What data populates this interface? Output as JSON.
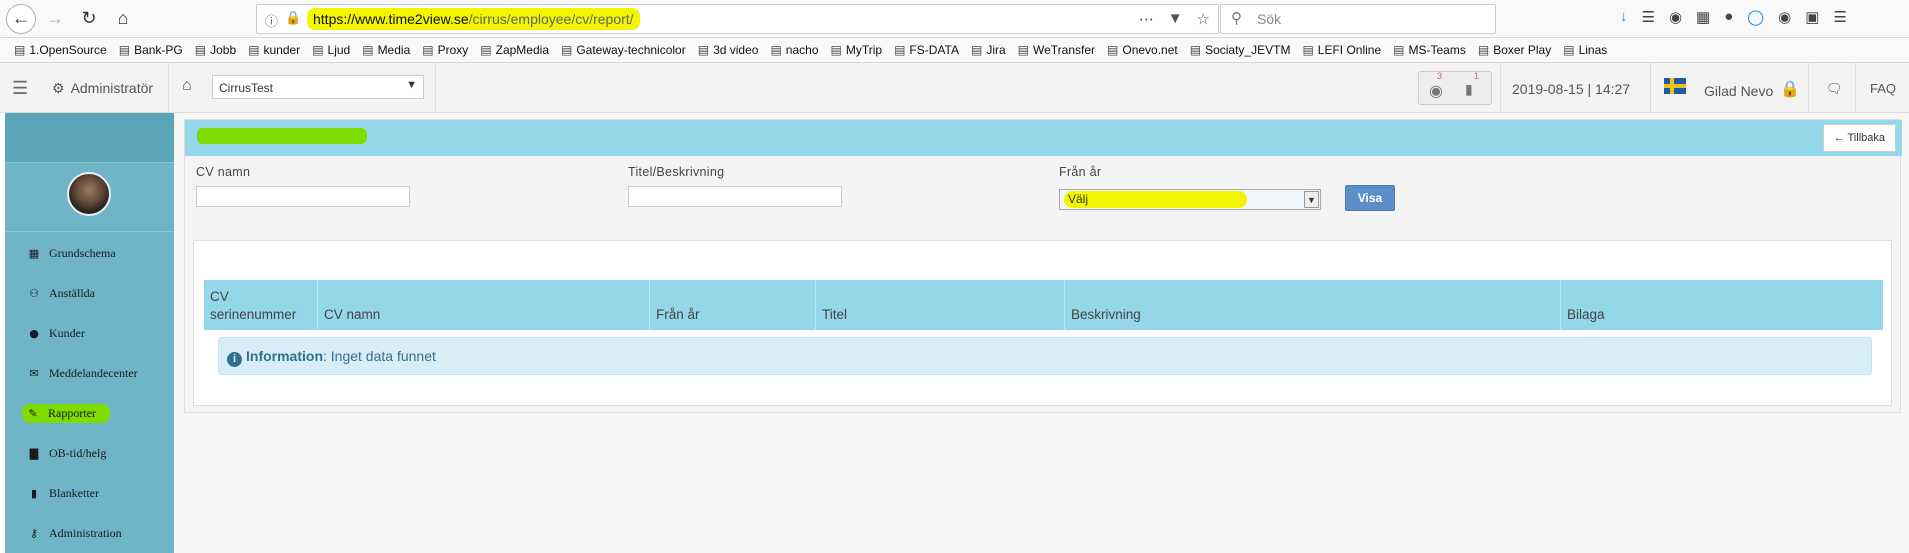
{
  "browser": {
    "url_domain": "https://www.time2view.se",
    "url_path": "/cirrus/employee/cv/report/",
    "search_placeholder": "Sök",
    "bookmarks": [
      "1.OpenSource",
      "Bank-PG",
      "Jobb",
      "kunder",
      "Ljud",
      "Media",
      "Proxy",
      "ZapMedia",
      "Gateway-technicolor",
      "3d video",
      "nacho",
      "MyTrip",
      "FS-DATA",
      "Jira",
      "WeTransfer",
      "Onevo.net",
      "Sociaty_JEVTM",
      "LEFI Online",
      "MS-Teams",
      "Boxer Play",
      "Linas"
    ]
  },
  "header": {
    "role": "Administratör",
    "tenant": "CirrusTest",
    "badge_globe": "3",
    "badge_chart": "1",
    "datetime": "2019-08-15 | 14:27",
    "user": "Gilad Nevo",
    "faq": "FAQ"
  },
  "sidebar": {
    "items": [
      {
        "label": "Grundschema",
        "icon": "calendar-icon"
      },
      {
        "label": "Anställda",
        "icon": "users-icon"
      },
      {
        "label": "Kunder",
        "icon": "user-icon"
      },
      {
        "label": "Meddelandecenter",
        "icon": "envelope-icon"
      },
      {
        "label": "Rapporter",
        "icon": "pencil-icon"
      },
      {
        "label": "OB-tid/helg",
        "icon": "bar-chart-icon"
      },
      {
        "label": "Blanketter",
        "icon": "file-icon"
      },
      {
        "label": "Administration",
        "icon": "key-icon"
      }
    ]
  },
  "filters": {
    "cv_name_label": "CV namn",
    "title_desc_label": "Titel/Beskrivning",
    "from_year_label": "Från år",
    "from_year_value": "Välj",
    "show_button": "Visa",
    "back_button": "Tillbaka"
  },
  "table": {
    "columns": [
      "CV serinenummer",
      "CV namn",
      "Från år",
      "Titel",
      "Beskrivning",
      "Bilaga"
    ],
    "info_title": "Information",
    "info_text": ": Inget data funnet"
  },
  "colors": {
    "sidebar": "#6fb5c7",
    "table_header": "#93d7e8",
    "highlight": "#f4f500",
    "active_highlight": "#7fdc00",
    "button": "#5b8fc7"
  }
}
